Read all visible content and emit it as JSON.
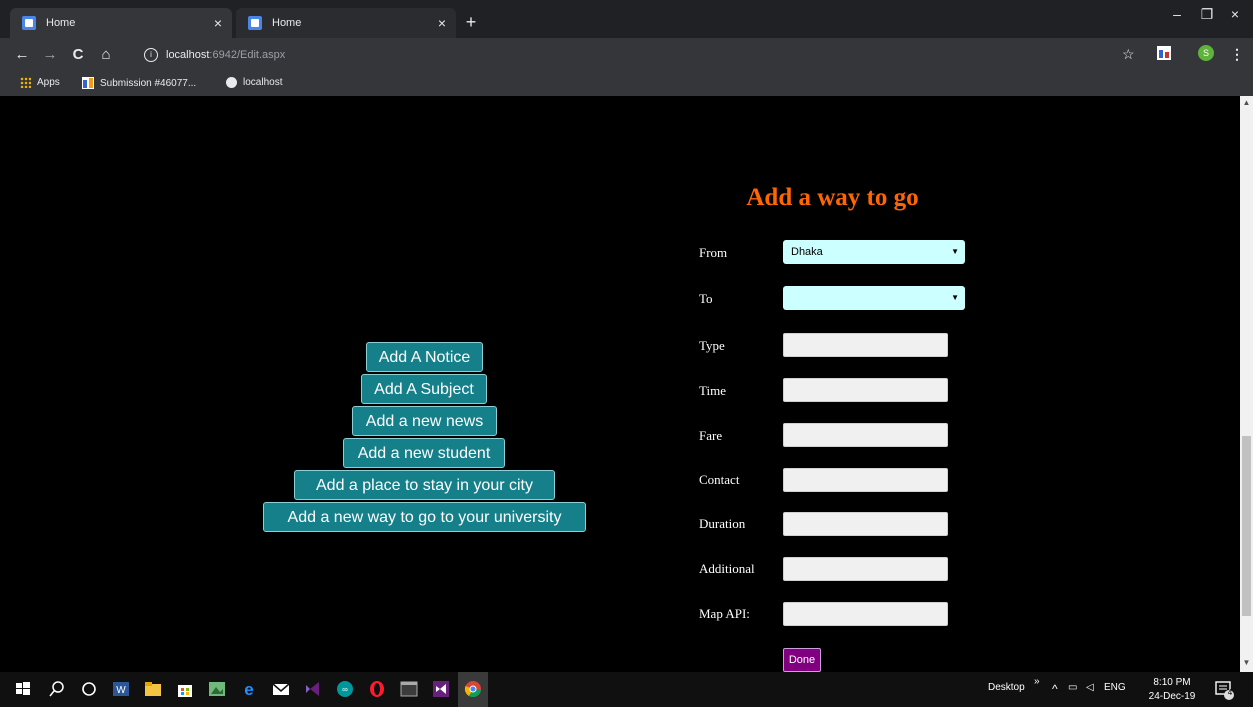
{
  "browser": {
    "tabs": [
      {
        "title": "Home",
        "close": "×"
      },
      {
        "title": "Home",
        "close": "×"
      }
    ],
    "new_tab": "+",
    "window_controls": {
      "minimize": "–",
      "restore": "❐",
      "close": "×"
    },
    "nav": {
      "back": "←",
      "forward": "→",
      "reload": "C",
      "home": "⌂"
    },
    "url_info": "i",
    "url_host": "localhost",
    "url_rest": ":6942/Edit.aspx",
    "star": "☆",
    "profile_initial": "S",
    "menu": "⋮",
    "bookmarks": [
      {
        "label": "Apps",
        "icon": "apps-grid-icon"
      },
      {
        "label": "Submission #46077...",
        "icon": "submission-favicon"
      },
      {
        "label": "localhost",
        "icon": "globe-icon"
      }
    ]
  },
  "sidebar_buttons": [
    "Add A Notice",
    "Add A Subject",
    "Add a new news",
    "Add a new student",
    "Add a place to stay in your city",
    "Add a new way to go to your university"
  ],
  "form": {
    "title": "Add a way to go",
    "from_label": "From",
    "from_value": "Dhaka",
    "to_label": "To",
    "to_value": "",
    "type_label": "Type",
    "time_label": "Time",
    "fare_label": "Fare",
    "contact_label": "Contact",
    "duration_label": "Duration",
    "additional_label": "Additional",
    "map_api_label": "Map API:",
    "done_label": "Done"
  },
  "taskbar": {
    "desktop_label": "Desktop",
    "chevron": "»",
    "lang": "ENG",
    "time": "8:10 PM",
    "date": "24-Dec-19",
    "notification_count": "4"
  },
  "colors": {
    "menu_button_bg": "#15808a",
    "form_title": "#ff6600",
    "select_bg": "#ccffff",
    "done_bg": "#800080"
  }
}
